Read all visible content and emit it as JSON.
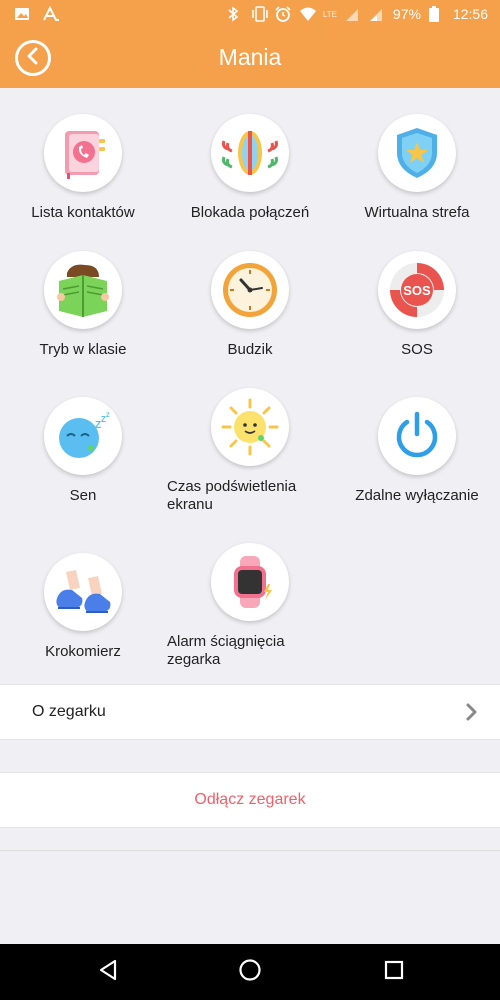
{
  "status_bar": {
    "icons_left": [
      "image-icon",
      "text-a-icon"
    ],
    "icons_right": [
      "bluetooth-icon",
      "vibrate-icon",
      "alarm-icon",
      "wifi-icon",
      "signal-lte-icon",
      "signal-icon",
      "signal-icon"
    ],
    "lte": "LTE",
    "battery": "97%",
    "time": "12:56"
  },
  "header": {
    "title": "Mania"
  },
  "features": [
    {
      "label": "Lista kontaktów",
      "icon": "contacts-book-icon"
    },
    {
      "label": "Blokada połączeń",
      "icon": "call-block-icon"
    },
    {
      "label": "Wirtualna strefa",
      "icon": "shield-star-icon"
    },
    {
      "label": "Tryb w klasie",
      "icon": "reading-boy-icon"
    },
    {
      "label": "Budzik",
      "icon": "alarm-clock-icon"
    },
    {
      "label": "SOS",
      "icon": "sos-lifebuoy-icon"
    },
    {
      "label": "Sen",
      "icon": "sleep-face-icon"
    },
    {
      "label": "Czas podświetlenia ekranu",
      "icon": "sun-face-icon"
    },
    {
      "label": "Zdalne wyłączanie",
      "icon": "power-icon"
    },
    {
      "label": "Krokomierz",
      "icon": "shoes-icon"
    },
    {
      "label": "Alarm ściągnięcia zegarka",
      "icon": "watch-alarm-icon"
    }
  ],
  "about": {
    "label": "O zegarku"
  },
  "disconnect": {
    "label": "Odłącz zegarek"
  },
  "colors": {
    "accent": "#f5a04a",
    "background": "#efeff4",
    "danger_text": "#f0616b"
  }
}
